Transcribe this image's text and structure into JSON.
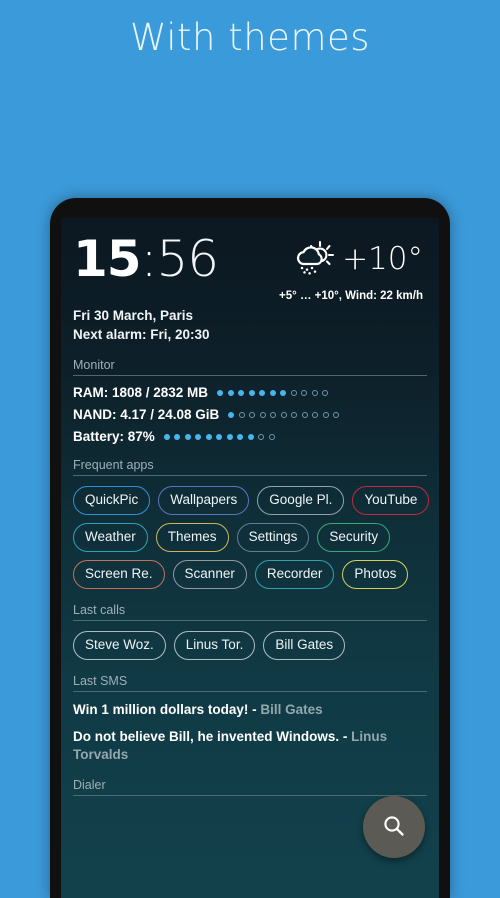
{
  "promo": {
    "title": "With themes"
  },
  "statusbar": {
    "visible": true
  },
  "clock": {
    "hours": "15",
    "colon": ":",
    "minutes": "56",
    "date_location": "Fri 30 March, Paris",
    "next_alarm": "Next alarm: Fri, 20:30"
  },
  "weather": {
    "icon": "sun-behind-rain-cloud-icon",
    "temperature": "+10°",
    "details": "+5° … +10°, Wind: 22 km/h"
  },
  "sections": {
    "monitor": "Monitor",
    "frequent_apps": "Frequent apps",
    "last_calls": "Last calls",
    "last_sms": "Last SMS",
    "dialer": "Dialer"
  },
  "monitor": {
    "rows": [
      {
        "label": "RAM: 1808 / 2832 MB",
        "dots_on": 7,
        "dots_off": 4
      },
      {
        "label": "NAND: 4.17 / 24.08 GiB",
        "dots_on": 1,
        "dots_off": 10
      },
      {
        "label": "Battery: 87%",
        "dots_on": 9,
        "dots_off": 2
      }
    ],
    "dot_on_color": "#47b6ee",
    "dot_off_color": "#6f98ab"
  },
  "frequent_apps": {
    "rows": [
      [
        {
          "label": "QuickPic",
          "color": "#2f8fd8"
        },
        {
          "label": "Wallpapers",
          "color": "#5a74c4"
        },
        {
          "label": "Google Pl.",
          "color": "#cba councils"
        },
        {
          "label": "YouTube",
          "color": "#c2283c"
        }
      ],
      [
        {
          "label": "Weather",
          "color": "#2aa3b8"
        },
        {
          "label": "Themes",
          "color": "#cdb45f"
        },
        {
          "label": "Settings",
          "color": "#5f7e99"
        },
        {
          "label": "Security",
          "color": "#35a87a"
        }
      ],
      [
        {
          "label": "Screen Re.",
          "color": "#c1705e"
        },
        {
          "label": "Scanner",
          "color": "#8d9aa0"
        },
        {
          "label": "Recorder",
          "color": "#2fa0b0"
        },
        {
          "label": "Photos",
          "color": "#d2d05a"
        }
      ]
    ]
  },
  "last_calls": {
    "contacts": [
      {
        "label": "Steve Woz.",
        "color": "#aebcc2"
      },
      {
        "label": "Linus Tor.",
        "color": "#aebcc2"
      },
      {
        "label": "Bill Gates",
        "color": "#aebcc2"
      }
    ]
  },
  "last_sms": {
    "messages": [
      {
        "text": "Win 1 million dollars today!",
        "separator": " - ",
        "sender": "Bill Gates"
      },
      {
        "text": "Do not believe Bill, he invented Windows.",
        "separator": " - ",
        "sender": "Linus Torvalds"
      }
    ]
  },
  "fab": {
    "icon": "search-icon",
    "color": "#5c5a54"
  }
}
